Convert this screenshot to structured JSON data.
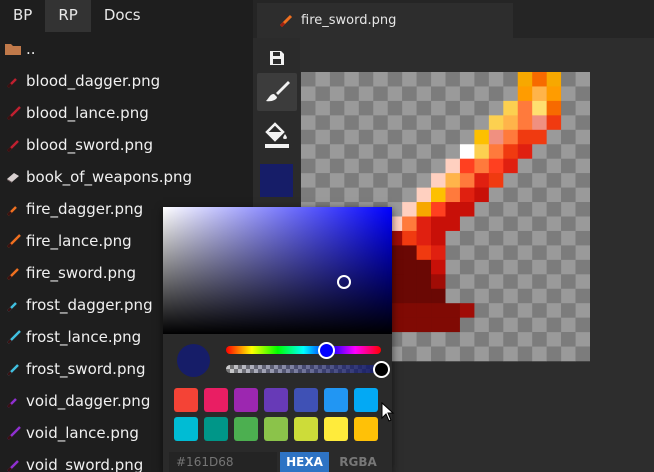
{
  "top_tabs": [
    {
      "label": "BP"
    },
    {
      "label": "RP",
      "active": true
    },
    {
      "label": "Docs"
    }
  ],
  "files": [
    {
      "name": "..",
      "icon": "folder-icon",
      "color": "#c0794a"
    },
    {
      "name": "blood_dagger.png",
      "icon": "dagger-icon",
      "color": "#c02030"
    },
    {
      "name": "blood_lance.png",
      "icon": "lance-icon",
      "color": "#c02030"
    },
    {
      "name": "blood_sword.png",
      "icon": "sword-icon",
      "color": "#c02030"
    },
    {
      "name": "book_of_weapons.png",
      "icon": "book-icon",
      "color": "#b0a0a0"
    },
    {
      "name": "fire_dagger.png",
      "icon": "dagger-icon",
      "color": "#f07020"
    },
    {
      "name": "fire_lance.png",
      "icon": "lance-icon",
      "color": "#f07020"
    },
    {
      "name": "fire_sword.png",
      "icon": "sword-icon",
      "color": "#f07020"
    },
    {
      "name": "frost_dagger.png",
      "icon": "dagger-icon",
      "color": "#40c0e0"
    },
    {
      "name": "frost_lance.png",
      "icon": "lance-icon",
      "color": "#40c0e0"
    },
    {
      "name": "frost_sword.png",
      "icon": "sword-icon",
      "color": "#40c0e0"
    },
    {
      "name": "void_dagger.png",
      "icon": "dagger-icon",
      "color": "#9030d0"
    },
    {
      "name": "void_lance.png",
      "icon": "lance-icon",
      "color": "#9030d0"
    },
    {
      "name": "void_sword.png",
      "icon": "sword-icon",
      "color": "#9030d0"
    }
  ],
  "editor": {
    "open_tab": "fire_sword.png"
  },
  "tools": [
    {
      "name": "save-icon"
    },
    {
      "name": "brush-icon",
      "active": true
    },
    {
      "name": "paint-bucket-icon"
    }
  ],
  "color_picker": {
    "current_color": "#161D68",
    "hue_color": "#0000ff",
    "hue_fraction": 0.65,
    "alpha_fraction": 1.0,
    "saturation_fraction": 0.79,
    "value_fraction": 0.41,
    "swatches": [
      "#f44336",
      "#e91e63",
      "#9c27b0",
      "#673ab7",
      "#3f51b5",
      "#2196f3",
      "#03a9f4",
      "#00bcd4",
      "#009688",
      "#4caf50",
      "#8bc34a",
      "#cddc39",
      "#ffeb3b",
      "#ffc107"
    ],
    "hex_placeholder": "#161D68",
    "mode_hexa": "HEXA",
    "mode_rgba": "RGBA"
  },
  "sprite": {
    "palette": {
      "A": "#f7a800",
      "B": "#f76a00",
      "C": "#ff9c00",
      "D": "#ffb44a",
      "E": "#ff7a3c",
      "F": "#f03a10",
      "G": "#ff4020",
      "H": "#fcd050",
      "I": "#ffe070",
      "W": "#ffffff",
      "P": "#ffd0c0",
      "K": "#f09080",
      "R": "#e02010",
      "S": "#c81008",
      "T": "#a00c06",
      "U": "#800a04",
      "V": "#6a0804",
      "X": "#fdc000"
    },
    "rows": [
      "...............ABA",
      "...............CDC",
      "..............HEIB",
      ".............HDEKF",
      "............XKEFF.",
      "...........WHEFR..",
      "..........PGEGR...",
      ".........PDERF....",
      "........PXERS.....",
      ".......PAGSS......",
      "......PERSS.......",
      ".....TTFRS........",
      "....VVVVFR........",
      "....VTVVVS........",
      "....UVVVVT........",
      "....UUVVVV........",
      "....UUUUUUUT......",
      "....UUUUUUU.......",
      "...................",
      "..................."
    ]
  }
}
